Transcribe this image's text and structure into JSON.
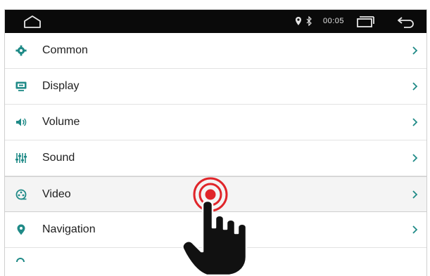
{
  "status_bar": {
    "time": "00:05",
    "icons": [
      "home-icon",
      "location-icon",
      "bluetooth-icon",
      "recent-apps-icon",
      "back-icon"
    ]
  },
  "menu": {
    "items": [
      {
        "label": "Common",
        "icon": "gear-icon"
      },
      {
        "label": "Display",
        "icon": "display-icon"
      },
      {
        "label": "Volume",
        "icon": "volume-icon"
      },
      {
        "label": "Sound",
        "icon": "equalizer-icon"
      },
      {
        "label": "Video",
        "icon": "video-icon",
        "selected": true
      },
      {
        "label": "Navigation",
        "icon": "map-pin-icon"
      }
    ]
  },
  "colors": {
    "accent": "#1f8a87",
    "status_bar_bg": "#0a0a0a",
    "tap_indicator": "#e0252a",
    "selected_row_bg": "#f4f4f4"
  }
}
